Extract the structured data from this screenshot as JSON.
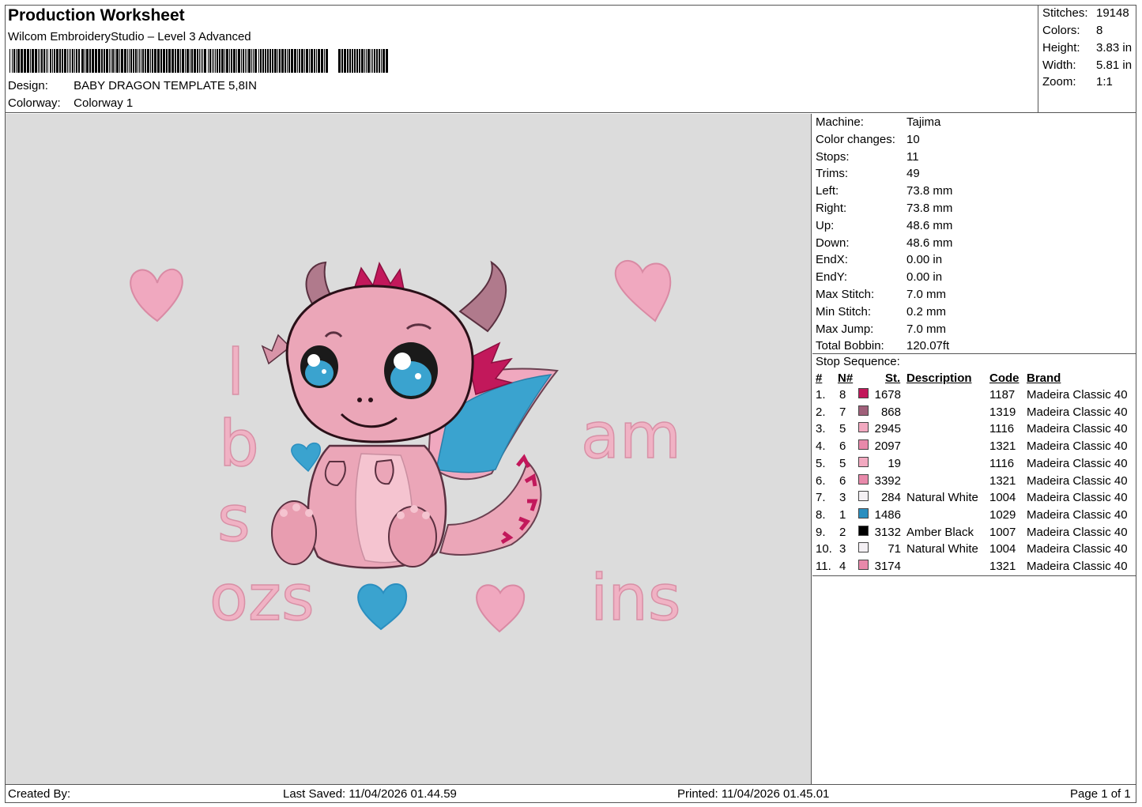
{
  "header": {
    "title": "Production Worksheet",
    "subtitle": "Wilcom EmbroideryStudio – Level 3 Advanced",
    "design_label": "Design:",
    "design_value": "BABY DRAGON TEMPLATE 5,8IN",
    "colorway_label": "Colorway:",
    "colorway_value": "Colorway 1"
  },
  "stats": [
    {
      "label": "Stitches:",
      "value": "19148"
    },
    {
      "label": "Colors:",
      "value": "8"
    },
    {
      "label": "Height:",
      "value": "3.83 in"
    },
    {
      "label": "Width:",
      "value": "5.81 in"
    },
    {
      "label": "Zoom:",
      "value": "1:1"
    }
  ],
  "machine_info": [
    {
      "label": "Machine:",
      "value": "Tajima"
    },
    {
      "label": "Color changes:",
      "value": "10"
    },
    {
      "label": "Stops:",
      "value": "11"
    },
    {
      "label": "Trims:",
      "value": "49"
    },
    {
      "label": "Left:",
      "value": "73.8 mm"
    },
    {
      "label": "Right:",
      "value": "73.8 mm"
    },
    {
      "label": "Up:",
      "value": "48.6 mm"
    },
    {
      "label": "Down:",
      "value": "48.6 mm"
    },
    {
      "label": "EndX:",
      "value": "0.00 in"
    },
    {
      "label": "EndY:",
      "value": "0.00 in"
    },
    {
      "label": "Max Stitch:",
      "value": "7.0 mm"
    },
    {
      "label": "Min Stitch:",
      "value": "0.2 mm"
    },
    {
      "label": "Max Jump:",
      "value": "7.0 mm"
    },
    {
      "label": "Total Bobbin:",
      "value": "120.07ft"
    }
  ],
  "stop_sequence": {
    "title": "Stop Sequence:",
    "columns": [
      "#",
      "N#",
      "St.",
      "Description",
      "Code",
      "Brand"
    ],
    "rows": [
      {
        "num": "1.",
        "n": "8",
        "color": "#c2185b",
        "st": "1678",
        "desc": "",
        "code": "1187",
        "brand": "Madeira Classic 40"
      },
      {
        "num": "2.",
        "n": "7",
        "color": "#a0607a",
        "st": "868",
        "desc": "",
        "code": "1319",
        "brand": "Madeira Classic 40"
      },
      {
        "num": "3.",
        "n": "5",
        "color": "#f2a9c0",
        "st": "2945",
        "desc": "",
        "code": "1116",
        "brand": "Madeira Classic 40"
      },
      {
        "num": "4.",
        "n": "6",
        "color": "#e889aa",
        "st": "2097",
        "desc": "",
        "code": "1321",
        "brand": "Madeira Classic 40"
      },
      {
        "num": "5.",
        "n": "5",
        "color": "#f2a9c0",
        "st": "19",
        "desc": "",
        "code": "1116",
        "brand": "Madeira Classic 40"
      },
      {
        "num": "6.",
        "n": "6",
        "color": "#e889aa",
        "st": "3392",
        "desc": "",
        "code": "1321",
        "brand": "Madeira Classic 40"
      },
      {
        "num": "7.",
        "n": "3",
        "color": "#f4f0f4",
        "st": "284",
        "desc": "Natural White",
        "code": "1004",
        "brand": "Madeira Classic 40"
      },
      {
        "num": "8.",
        "n": "1",
        "color": "#2b8fc0",
        "st": "1486",
        "desc": "",
        "code": "1029",
        "brand": "Madeira Classic 40"
      },
      {
        "num": "9.",
        "n": "2",
        "color": "#000000",
        "st": "3132",
        "desc": "Amber Black",
        "code": "1007",
        "brand": "Madeira Classic 40"
      },
      {
        "num": "10.",
        "n": "3",
        "color": "#f4f0f4",
        "st": "71",
        "desc": "Natural White",
        "code": "1004",
        "brand": "Madeira Classic 40"
      },
      {
        "num": "11.",
        "n": "4",
        "color": "#e889aa",
        "st": "3174",
        "desc": "",
        "code": "1321",
        "brand": "Madeira Classic 40"
      }
    ]
  },
  "design_text": {
    "l": "l",
    "b": "b",
    "s": "s",
    "ozs": "ozs",
    "am": "am",
    "ins": "ins"
  },
  "footer": {
    "created_by": "Created By:",
    "last_saved": "Last Saved: 11/04/2026 01.44.59",
    "printed": "Printed: 11/04/2026 01.45.01",
    "page": "Page 1 of 1"
  }
}
